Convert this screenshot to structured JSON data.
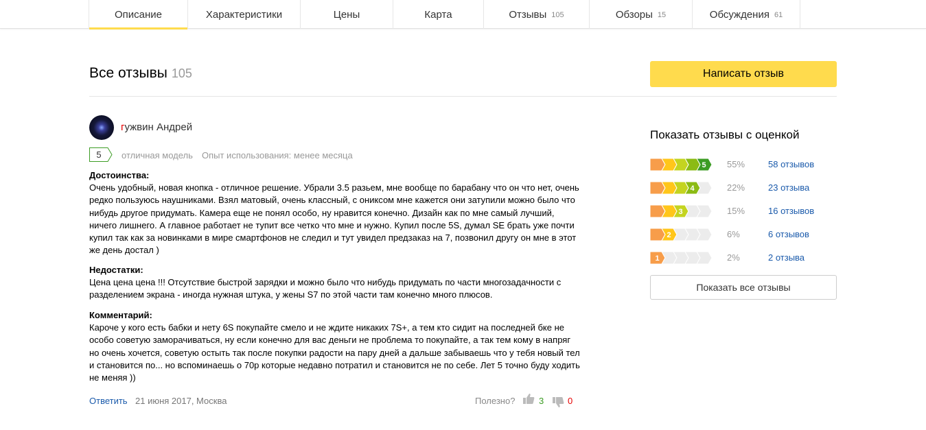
{
  "tabs": [
    {
      "label": "Описание",
      "count": ""
    },
    {
      "label": "Характеристики",
      "count": ""
    },
    {
      "label": "Цены",
      "count": ""
    },
    {
      "label": "Карта",
      "count": ""
    },
    {
      "label": "Отзывы",
      "count": "105"
    },
    {
      "label": "Обзоры",
      "count": "15"
    },
    {
      "label": "Обсуждения",
      "count": "61"
    }
  ],
  "page": {
    "title": "Все отзывы",
    "title_count": "105",
    "write_button": "Написать отзыв"
  },
  "review": {
    "author_first_letter": "г",
    "author_rest": "ужвин Андрей",
    "grade": "5",
    "grade_text": "отличная модель",
    "usage": "Опыт использования: менее месяца",
    "pros_head": "Достоинства:",
    "pros": "Очень удобный, новая кнопка - отличное решение. Убрали 3.5 разьем, мне вообще по барабану что он что нет, очень редко пользуюсь наушниками. Взял матовый, очень классный, с ониксом мне кажется они затупили можно было что нибудь другое придумать. Камера еще не понял особо, ну нравится конечно. Дизайн как по мне самый лучший, ничего лишнего. А главное работает не тупит все четко что мне и нужно. Купил после 5S, думал SE брать уже почти купил так как за новинками в мире смартфонов не следил и тут увидел предзаказ на 7, позвонил другу он мне в этот же день достал )",
    "cons_head": "Недостатки:",
    "cons": "Цена цена цена !!! Отсутствие быстрой зарядки и можно было что нибудь придумать по части многозадачности с разделением экрана - иногда нужная штука, у жены S7 по этой части там конечно много плюсов.",
    "comment_head": "Комментарий:",
    "comment": "Кароче у кого есть бабки и нету 6S покупайте смело и не ждите никаких 7S+, а тем кто сидит на последней бке не особо советую заморачиваться, ну если конечно для вас деньги не проблема то покупайте, а так тем кому в напряг но очень хочется, советую остыть так после покупки радости на пару дней а дальше забываешь что у тебя новый тел и становится по... но вспоминаешь о 70р которые недавно потратил и становится не по себе. Лет 5 точно буду ходить не меняя ))",
    "reply_label": "Ответить",
    "date_place": "21 июня 2017, Москва",
    "useful_label": "Полезно?",
    "likes": "3",
    "dislikes": "0"
  },
  "rating_filter": {
    "title": "Показать отзывы с оценкой",
    "rows": [
      {
        "stars": "5",
        "percent": "55%",
        "link": "58 отзывов"
      },
      {
        "stars": "4",
        "percent": "22%",
        "link": "23 отзыва"
      },
      {
        "stars": "3",
        "percent": "15%",
        "link": "16 отзывов"
      },
      {
        "stars": "2",
        "percent": "6%",
        "link": "6 отзывов"
      },
      {
        "stars": "1",
        "percent": "2%",
        "link": "2 отзыва"
      }
    ],
    "show_all": "Показать все отзывы"
  },
  "colors": {
    "accent_yellow": "#ffdb4d",
    "link_blue": "#1a5aab",
    "grade_green": "#3c9c24",
    "rating_1": "#f79d4a",
    "rating_2": "#ffc61a",
    "rating_3": "#c4d420",
    "rating_4": "#8bbb14",
    "rating_5": "#3c9c24",
    "rating_empty": "#ececec"
  }
}
